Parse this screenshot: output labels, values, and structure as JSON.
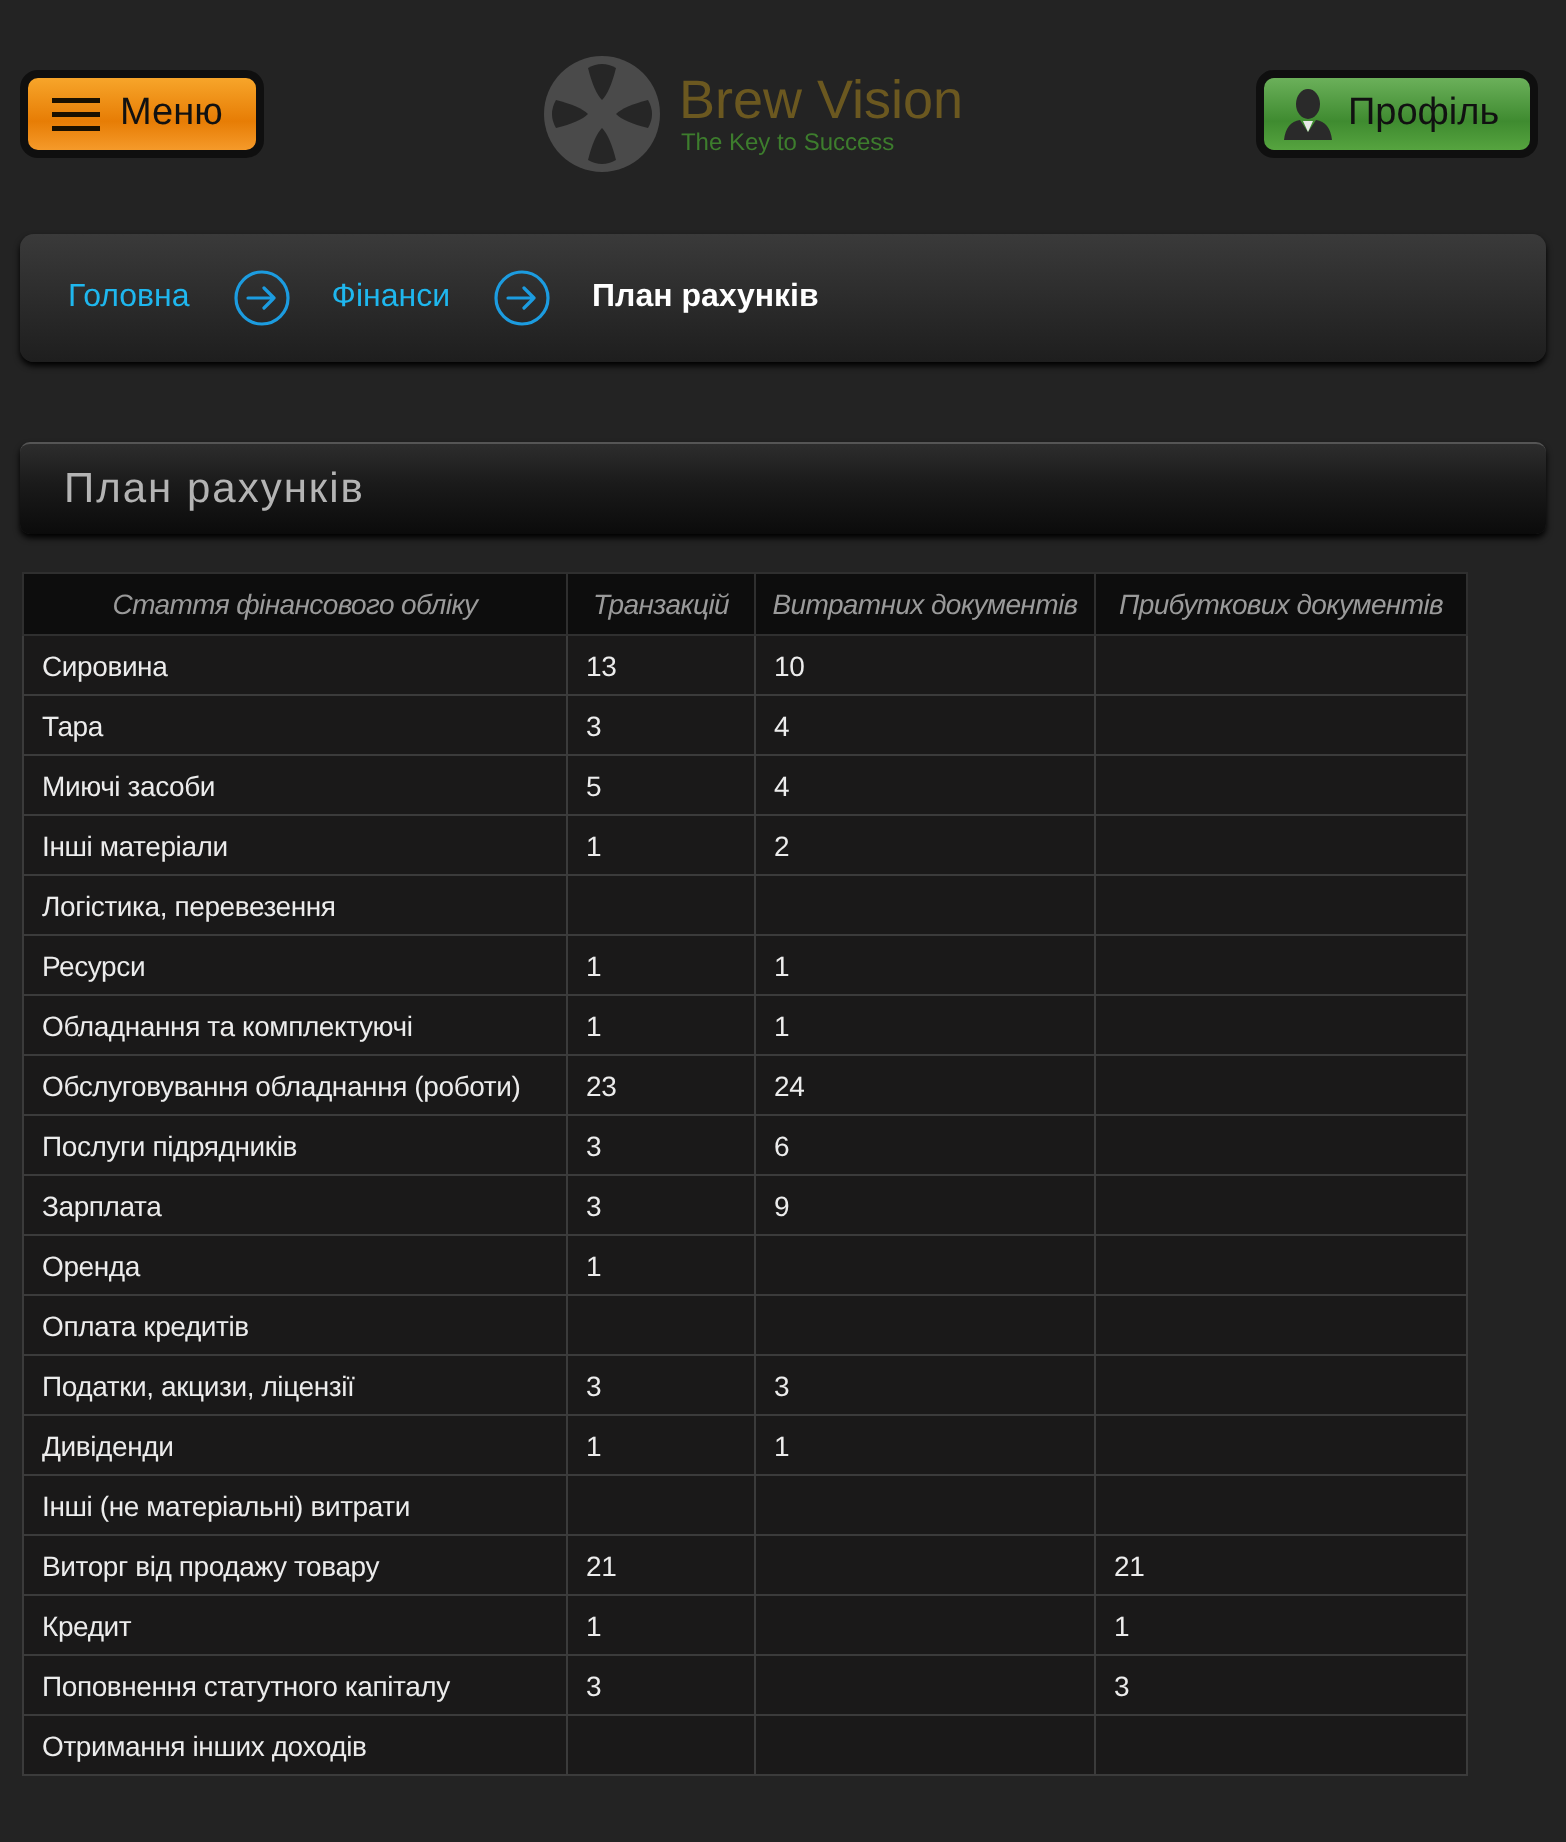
{
  "header": {
    "menu_button": {
      "label": "Меню"
    },
    "logo": {
      "name": "Brew Vision",
      "tagline": "The Key to Success"
    },
    "profile_button": {
      "label": "Профіль"
    }
  },
  "breadcrumb": [
    {
      "label": "Головна",
      "current": false
    },
    {
      "label": "Фінанси",
      "current": false
    },
    {
      "label": "План рахунків",
      "current": true
    }
  ],
  "page_title": "План рахунків",
  "table": {
    "columns": [
      "Стаття фінансового обліку",
      "Транзакцій",
      "Витратних документів",
      "Прибуткових документів"
    ],
    "rows": [
      {
        "item": "Сировина",
        "transactions": "13",
        "expense_docs": "10"
      },
      {
        "item": "Тара",
        "transactions": "3",
        "expense_docs": "4"
      },
      {
        "item": "Миючі засоби",
        "transactions": "5",
        "expense_docs": "4"
      },
      {
        "item": "Інші матеріали",
        "transactions": "1",
        "expense_docs": "2"
      },
      {
        "item": "Логістика, перевезення"
      },
      {
        "item": "Ресурси",
        "transactions": "1",
        "expense_docs": "1"
      },
      {
        "item": "Обладнання та комплектуючі",
        "transactions": "1",
        "expense_docs": "1"
      },
      {
        "item": "Обслуговування обладнання (роботи)",
        "transactions": "23",
        "expense_docs": "24"
      },
      {
        "item": "Послуги підрядників",
        "transactions": "3",
        "expense_docs": "6"
      },
      {
        "item": "Зарплата",
        "transactions": "3",
        "expense_docs": "9"
      },
      {
        "item": "Оренда",
        "transactions": "1"
      },
      {
        "item": "Оплата кредитів"
      },
      {
        "item": "Податки, акцизи, ліцензії",
        "transactions": "3",
        "expense_docs": "3"
      },
      {
        "item": "Дивіденди",
        "transactions": "1",
        "expense_docs": "1"
      },
      {
        "item": "Інші (не матеріальні) витрати"
      },
      {
        "item": "Виторг від продажу товару",
        "transactions": "21",
        "income_docs": "21"
      },
      {
        "item": "Кредит",
        "transactions": "1",
        "income_docs": "1"
      },
      {
        "item": "Поповнення статутного капіталу",
        "transactions": "3",
        "income_docs": "3"
      },
      {
        "item": "Отримання інших доходів"
      }
    ]
  }
}
